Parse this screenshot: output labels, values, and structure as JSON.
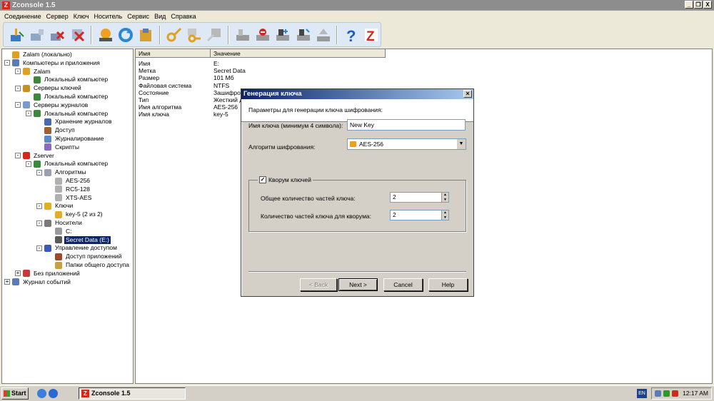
{
  "window": {
    "title": "Zconsole 1.5",
    "controls": [
      "_",
      "❐",
      "X"
    ]
  },
  "menu": [
    "Соединение",
    "Сервер",
    "Ключ",
    "Носитель",
    "Сервис",
    "Вид",
    "Справка"
  ],
  "toolbar_icons": [
    "connect-icon",
    "disconnect-icon",
    "delete-icon",
    "remove-icon",
    "server-icon",
    "refresh-icon",
    "archive-icon",
    "key-icon",
    "key-add-icon",
    "key-export-icon",
    "media-icon",
    "media-remove-icon",
    "media-mount-icon",
    "media-unmount-icon",
    "media-eject-icon",
    "help-icon",
    "zserver-icon"
  ],
  "tree": [
    {
      "label": "Zalam (локально)",
      "level": 0,
      "icon": "bell",
      "expander": null
    },
    {
      "label": "Компьютеры и приложения",
      "level": 0,
      "icon": "computers",
      "expander": "-"
    },
    {
      "label": "Zalam",
      "level": 1,
      "icon": "bell",
      "expander": "-"
    },
    {
      "label": "Локальный компьютер",
      "level": 2,
      "icon": "computer",
      "expander": null
    },
    {
      "label": "Серверы ключей",
      "level": 1,
      "icon": "keyserver",
      "expander": "-"
    },
    {
      "label": "Локальный компьютер",
      "level": 2,
      "icon": "computer",
      "expander": null
    },
    {
      "label": "Серверы журналов",
      "level": 1,
      "icon": "logserver",
      "expander": "-"
    },
    {
      "label": "Локальный компьютер",
      "level": 2,
      "icon": "computer",
      "expander": "-"
    },
    {
      "label": "Хранение журналов",
      "level": 3,
      "icon": "storage",
      "expander": null
    },
    {
      "label": "Доступ",
      "level": 3,
      "icon": "access",
      "expander": null
    },
    {
      "label": "Журналирование",
      "level": 3,
      "icon": "logging",
      "expander": null
    },
    {
      "label": "Скрипты",
      "level": 3,
      "icon": "scripts",
      "expander": null
    },
    {
      "label": "Zserver",
      "level": 1,
      "icon": "zserver",
      "expander": "-"
    },
    {
      "label": "Локальный компьютер",
      "level": 2,
      "icon": "computer",
      "expander": "-"
    },
    {
      "label": "Алгоритмы",
      "level": 3,
      "icon": "algorithms",
      "expander": "-"
    },
    {
      "label": "AES-256",
      "level": 4,
      "icon": "algo",
      "expander": null
    },
    {
      "label": "RC5-128",
      "level": 4,
      "icon": "algo",
      "expander": null
    },
    {
      "label": "XTS-AES",
      "level": 4,
      "icon": "algo",
      "expander": null
    },
    {
      "label": "Ключи",
      "level": 3,
      "icon": "keys",
      "expander": "-"
    },
    {
      "label": "key-5 (2 из 2)",
      "level": 4,
      "icon": "key",
      "expander": null
    },
    {
      "label": "Носители",
      "level": 3,
      "icon": "media",
      "expander": "-"
    },
    {
      "label": "C:",
      "level": 4,
      "icon": "drive",
      "expander": null
    },
    {
      "label": "Secret Data (E:)",
      "level": 4,
      "icon": "secure-drive",
      "expander": null,
      "selected": true
    },
    {
      "label": "Управление доступом",
      "level": 3,
      "icon": "shield",
      "expander": "-"
    },
    {
      "label": "Доступ приложений",
      "level": 4,
      "icon": "app-access",
      "expander": null
    },
    {
      "label": "Папки общего доступа",
      "level": 4,
      "icon": "shared",
      "expander": null
    },
    {
      "label": "Без приложений",
      "level": 1,
      "icon": "noapp",
      "expander": "+"
    },
    {
      "label": "Журнал событий",
      "level": 0,
      "icon": "eventlog",
      "expander": "+"
    }
  ],
  "details": {
    "headers": [
      "Имя",
      "Значение"
    ],
    "rows": [
      [
        "Имя",
        "E:"
      ],
      [
        "Метка",
        "Secret Data"
      ],
      [
        "Размер",
        "101 Мб"
      ],
      [
        "Файловая система",
        "NTFS"
      ],
      [
        "Состояние",
        "Зашифров"
      ],
      [
        "Тип",
        "Жесткий д"
      ],
      [
        "Имя алгоритма",
        "AES-256"
      ],
      [
        "Имя ключа",
        "key-5"
      ]
    ]
  },
  "dialog": {
    "title": "Генерация ключа",
    "header": "Параметры для генерации ключа шифрования:",
    "key_name_label": "Имя ключа (минимум 4 символа):",
    "key_name_value": "New Key",
    "algorithm_label": "Алгоритм шифрования:",
    "algorithm_value": "AES-256",
    "quorum_label": "Кворум ключей",
    "quorum_checked": true,
    "total_parts_label": "Общее количество частей ключа:",
    "total_parts_value": "2",
    "quorum_parts_label": "Количество частей ключа для кворума:",
    "quorum_parts_value": "2",
    "buttons": {
      "back": "< Back",
      "next": "Next >",
      "cancel": "Cancel",
      "help": "Help"
    }
  },
  "taskbar": {
    "start": "Start",
    "task": "Zconsole 1.5",
    "lang": "EN",
    "clock": "12:17 AM"
  },
  "colors": {
    "selection": "#0a246a",
    "dialog_face": "#d4d0c8",
    "accent_red": "#d8261c"
  }
}
